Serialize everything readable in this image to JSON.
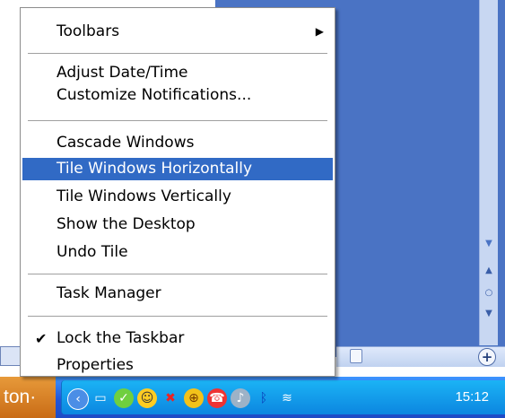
{
  "menu": {
    "items": [
      {
        "label": "Toolbars",
        "submenu": true
      },
      {
        "label": "Adjust Date/Time"
      },
      {
        "label": "Customize Notifications..."
      },
      {
        "label": "Cascade Windows"
      },
      {
        "label": "Tile Windows Horizontally",
        "selected": true
      },
      {
        "label": "Tile Windows Vertically"
      },
      {
        "label": "Show the Desktop"
      },
      {
        "label": "Undo Tile"
      },
      {
        "label": "Task Manager"
      },
      {
        "label": "Lock the Taskbar",
        "checked": true
      },
      {
        "label": "Properties"
      }
    ]
  },
  "taskbar": {
    "start_fragment": "ton·",
    "clock": "15:12",
    "tray_icons": [
      "back-arrow-icon",
      "network-icon",
      "messenger-icon",
      "chat-icon",
      "network-disconnected-icon",
      "globe-icon",
      "phone-icon",
      "audio-icon",
      "bluetooth-icon",
      "wireless-icon"
    ]
  },
  "colors": {
    "highlight": "#316ac5",
    "taskbar": "#2256d9",
    "tray": "#0c86e0",
    "start": "#c96b16"
  }
}
